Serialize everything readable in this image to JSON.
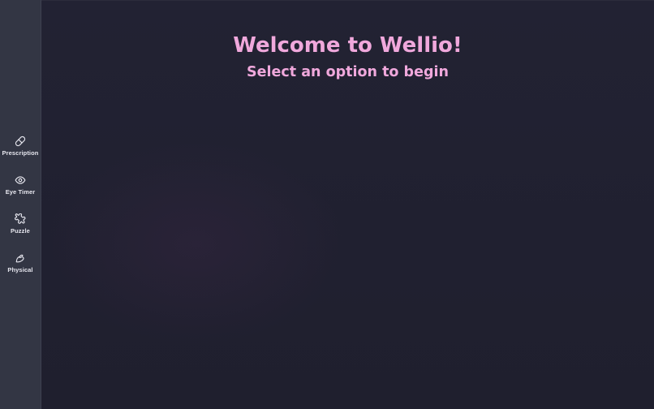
{
  "app": {
    "title": "Welcome to Wellio!",
    "subtitle": "Select an option to begin"
  },
  "sidebar": {
    "items": [
      {
        "label": "Prescription",
        "icon": "pill-icon"
      },
      {
        "label": "Eye Timer",
        "icon": "eye-icon"
      },
      {
        "label": "Puzzle",
        "icon": "puzzle-icon"
      },
      {
        "label": "Physical",
        "icon": "activity-icon"
      }
    ]
  },
  "colors": {
    "accent": "#f0a8dc",
    "sidebar_bg": "#333644",
    "main_bg": "#1e1e2e"
  }
}
